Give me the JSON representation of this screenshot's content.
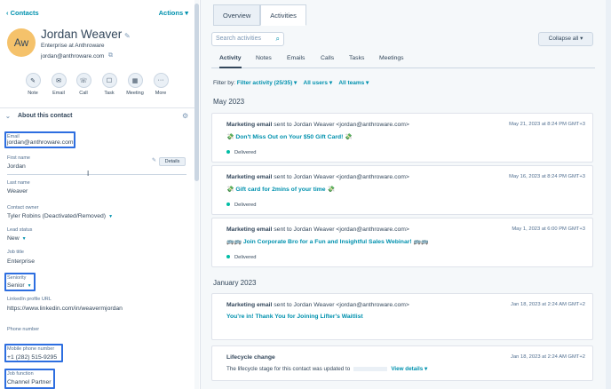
{
  "left": {
    "back_label": "Contacts",
    "actions_label": "Actions",
    "avatar_initials": "Aw",
    "contact_name": "Jordan Weaver",
    "subtitle": "Enterprise at Anthroware",
    "email": "jordan@anthroware.com",
    "quick_actions": [
      "Note",
      "Email",
      "Call",
      "Task",
      "Meeting",
      "More"
    ],
    "section_title": "About this contact",
    "properties": {
      "email_label": "Email",
      "email_value": "jordan@anthroware.com",
      "first_name_label": "First name",
      "first_name_value": "Jordan",
      "details_button": "Details",
      "last_name_label": "Last name",
      "last_name_value": "Weaver",
      "owner_label": "Contact owner",
      "owner_value": "Tyler Robins (Deactivated/Removed)",
      "lead_status_label": "Lead status",
      "lead_status_value": "New",
      "job_title_label": "Job title",
      "job_title_value": "Enterprise",
      "seniority_label": "Seniority",
      "seniority_value": "Senior",
      "linkedin_label": "LinkedIn profile URL",
      "linkedin_value": "https://www.linkedin.com/in/weavermjordan",
      "phone_label": "Phone number",
      "mobile_label": "Mobile phone number",
      "mobile_value": "+1 (282) 515-9295",
      "job_function_label": "Job function",
      "job_function_value": "Channel Partner"
    }
  },
  "right": {
    "tabs": [
      "Overview",
      "Activities"
    ],
    "search_placeholder": "Search activities",
    "collapse_label": "Collapse all",
    "subtabs": [
      "Activity",
      "Notes",
      "Emails",
      "Calls",
      "Tasks",
      "Meetings"
    ],
    "filter_by": "Filter by:",
    "filter_activity": "Filter activity (25/35)",
    "all_users": "All users",
    "all_teams": "All teams",
    "months": [
      "May 2023",
      "January 2023"
    ],
    "cards": [
      {
        "type": "Marketing email",
        "sent_to": "sent to Jordan Weaver <jordan@anthroware.com>",
        "date": "May 21, 2023 at 8:24 PM GMT+3",
        "subject": "💸 Don't Miss Out on Your $50 Gift Card! 💸",
        "status": "Delivered"
      },
      {
        "type": "Marketing email",
        "sent_to": "sent to Jordan Weaver <jordan@anthroware.com>",
        "date": "May 16, 2023 at 8:24 PM GMT+3",
        "subject": "💸 Gift card for 2mins of your time 💸",
        "status": "Delivered"
      },
      {
        "type": "Marketing email",
        "sent_to": "sent to Jordan Weaver <jordan@anthroware.com>",
        "date": "May 1, 2023 at 6:00 PM GMT+3",
        "subject": "🚌🚌 Join Corporate Bro for a Fun and Insightful Sales Webinar! 🚌🚌",
        "status": "Delivered"
      },
      {
        "type": "Marketing email",
        "sent_to": "sent to Jordan Weaver <jordan@anthroware.com>",
        "date": "Jan 18, 2023 at 2:24 AM GMT+2",
        "subject": "You're in! Thank You for Joining Lifter's Waitlist"
      }
    ],
    "lifecycle": {
      "title": "Lifecycle change",
      "desc": "The lifecycle stage for this contact was updated to",
      "view_details": "View details",
      "date": "Jan 18, 2023 at 2:24 AM GMT+2"
    }
  }
}
